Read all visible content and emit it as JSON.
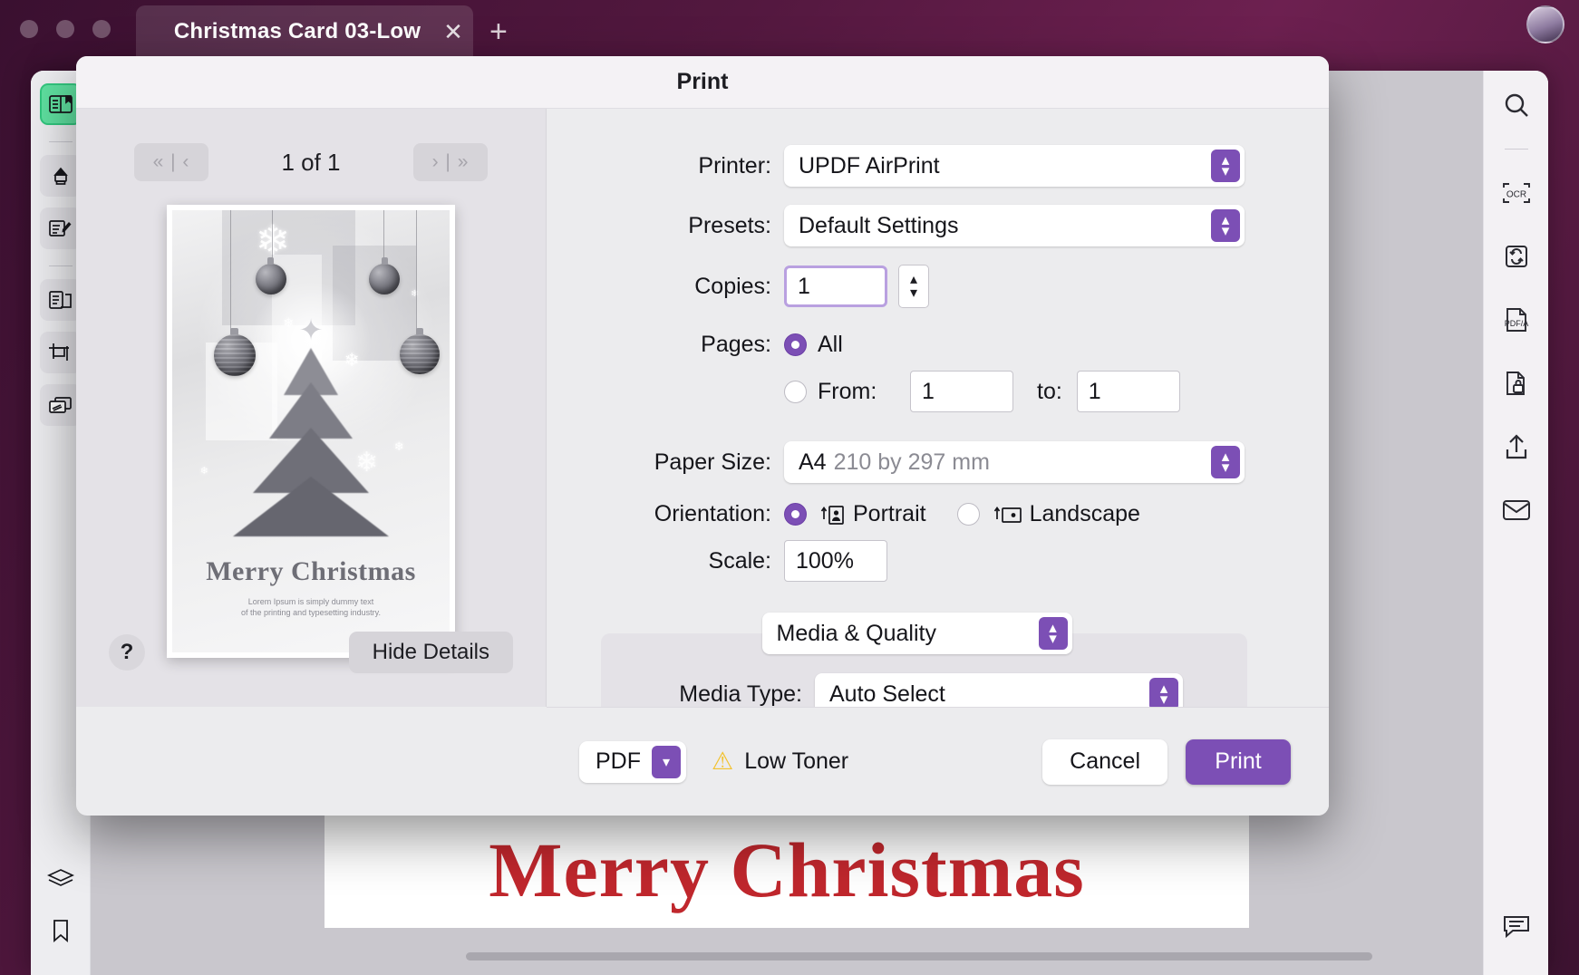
{
  "window": {
    "tab_title": "Christmas Card 03-Low",
    "tab_close_icon": "close-icon",
    "new_tab_icon": "plus-icon"
  },
  "left_rail": {
    "items": [
      {
        "icon": "reader-view-icon",
        "active": true
      },
      {
        "icon": "highlighter-icon",
        "active": false
      },
      {
        "icon": "edit-document-icon",
        "active": false
      },
      {
        "icon": "organize-pages-icon",
        "active": false
      },
      {
        "icon": "crop-page-icon",
        "active": false
      },
      {
        "icon": "page-background-icon",
        "active": false
      },
      {
        "icon": "layers-icon",
        "active": false
      },
      {
        "icon": "bookmark-icon",
        "active": false
      }
    ]
  },
  "right_rail": {
    "items": [
      {
        "icon": "search-icon"
      },
      {
        "icon": "ocr-icon"
      },
      {
        "icon": "convert-icon"
      },
      {
        "icon": "pdf-a-icon"
      },
      {
        "icon": "protect-icon"
      },
      {
        "icon": "share-icon"
      },
      {
        "icon": "mail-icon"
      },
      {
        "icon": "comment-icon"
      }
    ]
  },
  "document": {
    "heading": "Merry Christmas"
  },
  "dialog": {
    "title": "Print",
    "preview": {
      "prev_icon": "first-page-and-previous-page-icon",
      "next_icon": "next-page-and-last-page-icon",
      "page_label": "1 of 1",
      "card_heading": "Merry Christmas",
      "card_subtitle_line1": "Lorem Ipsum is simply dummy text",
      "card_subtitle_line2": "of the printing and typesetting industry.",
      "help_label": "?",
      "hide_details_label": "Hide Details"
    },
    "settings": {
      "printer_label": "Printer:",
      "printer_value": "UPDF AirPrint",
      "presets_label": "Presets:",
      "presets_value": "Default Settings",
      "copies_label": "Copies:",
      "copies_value": "1",
      "pages_label": "Pages:",
      "pages_all_label": "All",
      "pages_all_selected": true,
      "pages_from_label": "From:",
      "pages_from_value": "1",
      "pages_to_label": "to:",
      "pages_to_value": "1",
      "paper_size_label": "Paper Size:",
      "paper_size_value": "A4",
      "paper_size_dimensions": "210 by 297 mm",
      "orientation_label": "Orientation:",
      "orientation_portrait_label": "Portrait",
      "orientation_landscape_label": "Landscape",
      "orientation_portrait_selected": true,
      "scale_label": "Scale:",
      "scale_value": "100%",
      "section_select_value": "Media & Quality",
      "media_type_label": "Media Type:",
      "media_type_value": "Auto Select"
    },
    "footer": {
      "pdf_label": "PDF",
      "pdf_chevron_icon": "chevron-down-icon",
      "status_icon": "warning-triangle-icon",
      "status_label": "Low Toner",
      "cancel_label": "Cancel",
      "print_label": "Print"
    }
  },
  "colors": {
    "accent_purple": "#7c4fb5",
    "accent_green": "#5fe0a0",
    "warning_yellow": "#f2c230",
    "document_red": "#c0272d"
  }
}
